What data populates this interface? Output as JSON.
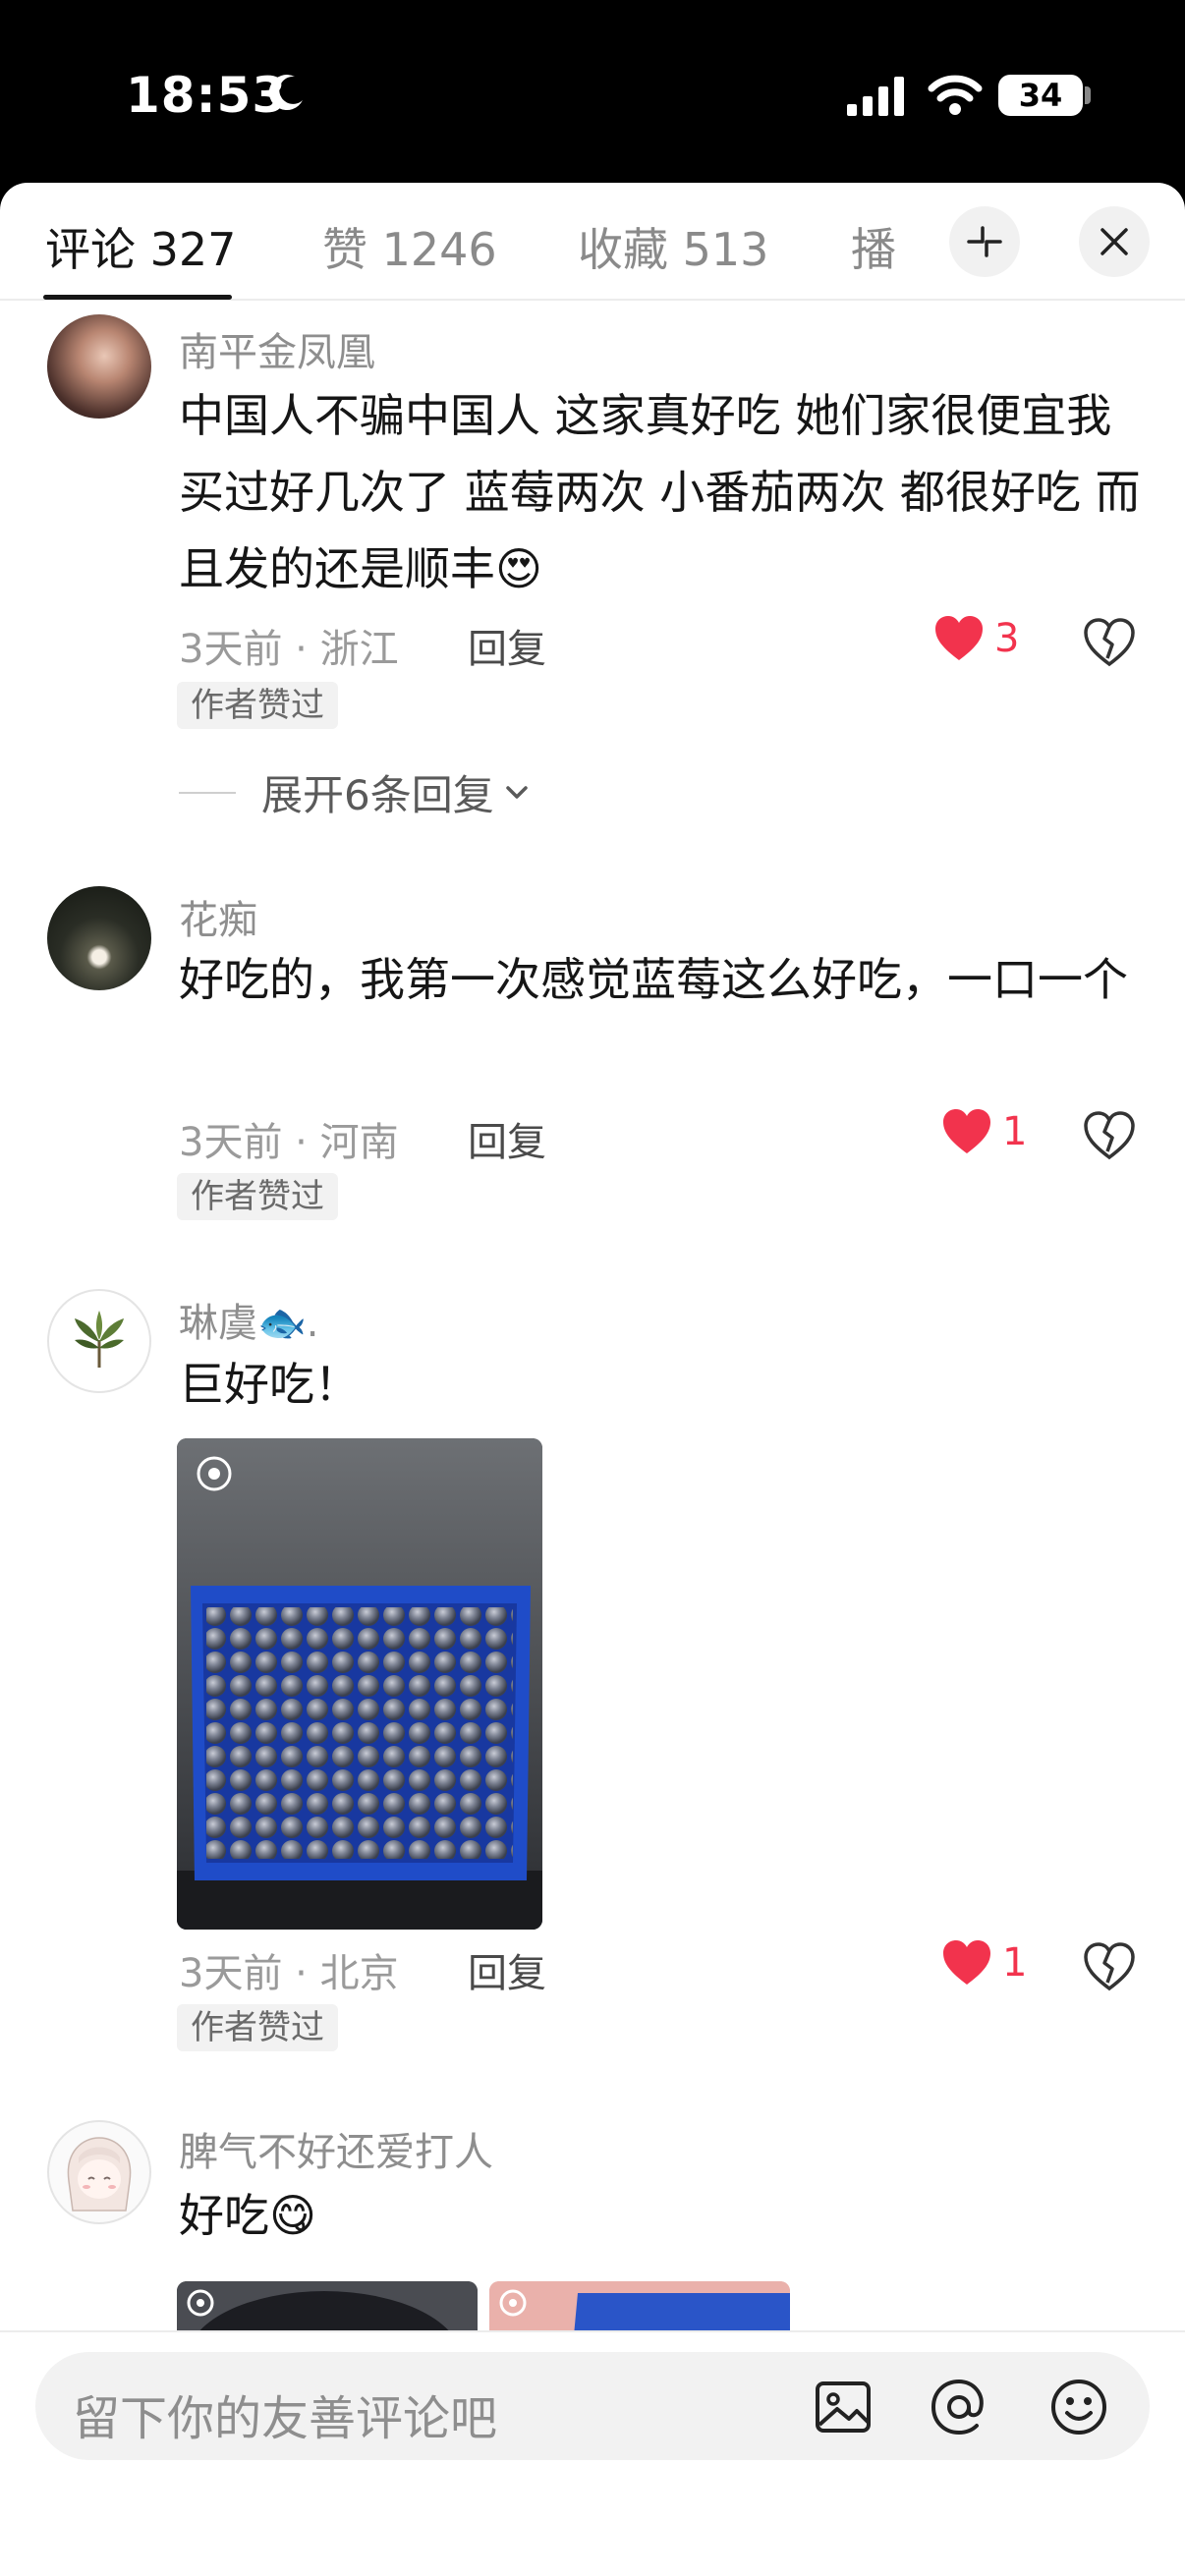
{
  "status_bar": {
    "time": "18:53",
    "battery": "34"
  },
  "tabs": [
    {
      "label": "评论 327"
    },
    {
      "label": "赞 1246"
    },
    {
      "label": "收藏 513"
    },
    {
      "label": "播"
    }
  ],
  "comments": [
    {
      "username": "南平金凤凰",
      "text": "中国人不骗中国人 这家真好吃 她们家很便宜我买过好几次了 蓝莓两次 小番茄两次 都很好吃 而且发的还是顺丰😍",
      "time_location": "3天前 · 浙江",
      "reply": "回复",
      "likes": "3",
      "badge": "作者赞过",
      "expand": "展开6条回复"
    },
    {
      "username": "花痴",
      "text": "好吃的，我第一次感觉蓝莓这么好吃，一口一个",
      "time_location": "3天前 · 河南",
      "reply": "回复",
      "likes": "1",
      "badge": "作者赞过"
    },
    {
      "username": "琳虞🐟.",
      "text": "巨好吃！",
      "time_location": "3天前 · 北京",
      "reply": "回复",
      "likes": "1",
      "badge": "作者赞过"
    },
    {
      "username": "脾气不好还爱打人",
      "text": "好吃😋"
    }
  ],
  "input": {
    "placeholder": "留下你的友善评论吧"
  },
  "colors": {
    "like_red": "#f2334d",
    "text_primary": "#161616",
    "text_secondary": "#8e8e8e"
  }
}
